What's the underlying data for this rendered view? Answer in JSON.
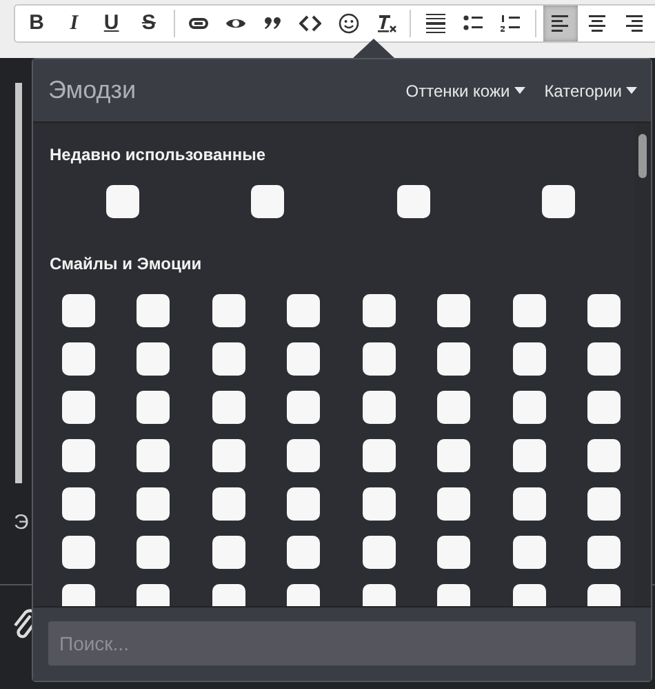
{
  "toolbar": {
    "groups": [
      [
        {
          "kind": "text",
          "label": "B",
          "selected": false
        },
        {
          "kind": "text",
          "label": "I",
          "selected": false
        },
        {
          "kind": "text",
          "label": "U",
          "selected": false
        },
        {
          "kind": "text",
          "label": "S",
          "selected": false
        }
      ],
      [
        {
          "kind": "link",
          "selected": false
        },
        {
          "kind": "preview",
          "selected": false
        },
        {
          "kind": "quote",
          "selected": false
        },
        {
          "kind": "code",
          "selected": false
        },
        {
          "kind": "emoji",
          "selected": false
        },
        {
          "kind": "clear",
          "selected": false
        }
      ],
      [
        {
          "kind": "rule",
          "selected": false
        },
        {
          "kind": "bullets",
          "selected": false
        },
        {
          "kind": "numbers",
          "selected": false
        }
      ],
      [
        {
          "kind": "align-left",
          "selected": true
        },
        {
          "kind": "align-center",
          "selected": false
        },
        {
          "kind": "align-right",
          "selected": false
        }
      ]
    ]
  },
  "background_text": "Э",
  "popover": {
    "title": "Эмодзи",
    "menus": [
      {
        "label": "Оттенки кожи"
      },
      {
        "label": "Категории"
      }
    ],
    "sections": [
      {
        "title": "Недавно использованные",
        "kind": "spread",
        "rows": [
          [
            {
              "kind": "blank"
            },
            {
              "kind": "blank"
            },
            {
              "kind": "blank"
            },
            {
              "kind": "blank"
            }
          ]
        ]
      },
      {
        "title": "Смайлы и Эмоции",
        "kind": "grid",
        "rows": [
          [
            {
              "kind": "blank"
            },
            {
              "kind": "blank"
            },
            {
              "kind": "blank"
            },
            {
              "kind": "blank"
            },
            {
              "kind": "blank"
            },
            {
              "kind": "blank"
            },
            {
              "kind": "blank"
            },
            {
              "kind": "blank"
            }
          ],
          [
            {
              "kind": "blank"
            },
            {
              "kind": "blank"
            },
            {
              "kind": "blank"
            },
            {
              "kind": "blank"
            },
            {
              "kind": "blank"
            },
            {
              "kind": "blank"
            },
            {
              "kind": "blank"
            },
            {
              "kind": "blank"
            }
          ],
          [
            {
              "kind": "blank"
            },
            {
              "kind": "blank"
            },
            {
              "kind": "blank"
            },
            {
              "kind": "blank"
            },
            {
              "kind": "blank"
            },
            {
              "kind": "blank"
            },
            {
              "kind": "blank"
            },
            {
              "kind": "blank"
            }
          ],
          [
            {
              "kind": "blank"
            },
            {
              "kind": "blank"
            },
            {
              "kind": "blank"
            },
            {
              "kind": "blank"
            },
            {
              "kind": "blank"
            },
            {
              "kind": "blank"
            },
            {
              "kind": "blank"
            },
            {
              "kind": "blank"
            }
          ],
          [
            {
              "kind": "blank"
            },
            {
              "kind": "blank"
            },
            {
              "kind": "blank"
            },
            {
              "kind": "blank"
            },
            {
              "kind": "blank"
            },
            {
              "kind": "blank"
            },
            {
              "kind": "blank"
            },
            {
              "kind": "blank"
            }
          ],
          [
            {
              "kind": "blank"
            },
            {
              "kind": "blank"
            },
            {
              "kind": "blank"
            },
            {
              "kind": "blank"
            },
            {
              "kind": "blank"
            },
            {
              "kind": "blank"
            },
            {
              "kind": "blank"
            },
            {
              "kind": "blank"
            }
          ],
          [
            {
              "kind": "blank"
            },
            {
              "kind": "blank"
            },
            {
              "kind": "blank"
            },
            {
              "kind": "blank"
            },
            {
              "kind": "blank"
            },
            {
              "kind": "blank"
            },
            {
              "kind": "blank"
            },
            {
              "kind": "blank"
            }
          ]
        ]
      }
    ],
    "search": {
      "placeholder": "Поиск..."
    }
  }
}
